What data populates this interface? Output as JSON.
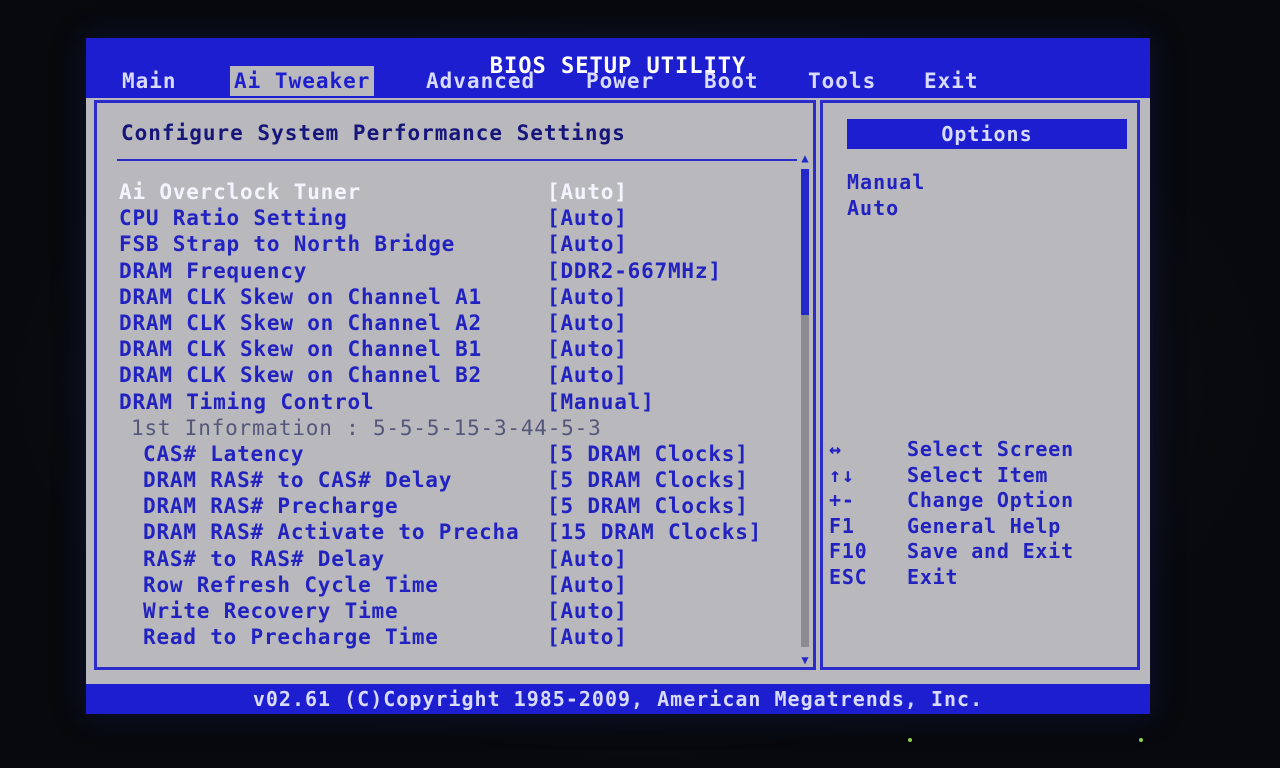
{
  "window": {
    "title": "BIOS SETUP UTILITY"
  },
  "menu": [
    {
      "label": "Main",
      "active": false
    },
    {
      "label": "Ai Tweaker",
      "active": true
    },
    {
      "label": "Advanced",
      "active": false
    },
    {
      "label": "Power",
      "active": false
    },
    {
      "label": "Boot",
      "active": false
    },
    {
      "label": "Tools",
      "active": false
    },
    {
      "label": "Exit",
      "active": false
    }
  ],
  "main": {
    "title": "Configure System Performance Settings",
    "rows": [
      {
        "label": "Ai Overclock Tuner",
        "value": "[Auto]"
      },
      {
        "label": "CPU Ratio Setting",
        "value": "[Auto]"
      },
      {
        "label": "FSB Strap to North Bridge",
        "value": "[Auto]"
      },
      {
        "label": "DRAM Frequency",
        "value": "[DDR2-667MHz]"
      },
      {
        "label": "DRAM CLK Skew on Channel A1",
        "value": "[Auto]"
      },
      {
        "label": "DRAM CLK Skew on Channel A2",
        "value": "[Auto]"
      },
      {
        "label": "DRAM CLK Skew on Channel B1",
        "value": "[Auto]"
      },
      {
        "label": "DRAM CLK Skew on Channel B2",
        "value": "[Auto]"
      },
      {
        "label": "DRAM Timing Control",
        "value": "[Manual]"
      },
      {
        "label": "1st Information : 5-5-5-15-3-44-5-3",
        "value": ""
      },
      {
        "label": "CAS# Latency",
        "value": "[5 DRAM Clocks]"
      },
      {
        "label": "DRAM RAS# to CAS# Delay",
        "value": "[5 DRAM Clocks]"
      },
      {
        "label": "DRAM RAS# Precharge",
        "value": "[5 DRAM Clocks]"
      },
      {
        "label": "DRAM RAS# Activate to Precha",
        "value": "[15 DRAM Clocks]"
      },
      {
        "label": "RAS# to RAS# Delay",
        "value": "[Auto]"
      },
      {
        "label": "Row Refresh Cycle Time",
        "value": "[Auto]"
      },
      {
        "label": "Write Recovery Time",
        "value": "[Auto]"
      },
      {
        "label": "Read to Precharge Time",
        "value": "[Auto]"
      }
    ]
  },
  "options": {
    "title": "Options",
    "items": [
      "Manual",
      "Auto"
    ]
  },
  "help": [
    {
      "key": "↔",
      "desc": "Select Screen"
    },
    {
      "key": "↑↓",
      "desc": "Select Item"
    },
    {
      "key": "+-",
      "desc": "Change Option"
    },
    {
      "key": "F1",
      "desc": "General Help"
    },
    {
      "key": "F10",
      "desc": "Save and Exit"
    },
    {
      "key": "ESC",
      "desc": "Exit"
    }
  ],
  "footer": {
    "text": "v02.61 (C)Copyright 1985-2009, American Megatrends, Inc."
  },
  "colors": {
    "accent": "#1c1ecf",
    "panel": "#b9b9bd",
    "text": "#2222c0",
    "highlight": "#f4f4ff"
  }
}
